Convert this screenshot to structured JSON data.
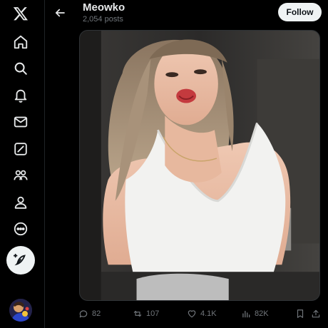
{
  "header": {
    "title": "Meowko",
    "subtitle": "2,054 posts",
    "follow_label": "Follow"
  },
  "nav": [
    "x-logo-icon",
    "home-icon",
    "search-icon",
    "notifications-icon",
    "messages-icon",
    "grok-icon",
    "communities-icon",
    "profile-icon",
    "more-icon"
  ],
  "post": {
    "replies": "82",
    "reposts": "107",
    "likes": "4.1K",
    "views": "82K"
  },
  "colors": {
    "background": "#000000",
    "text": "#e7e9ea",
    "muted": "#71767b",
    "button_bg": "#eff3f4"
  }
}
